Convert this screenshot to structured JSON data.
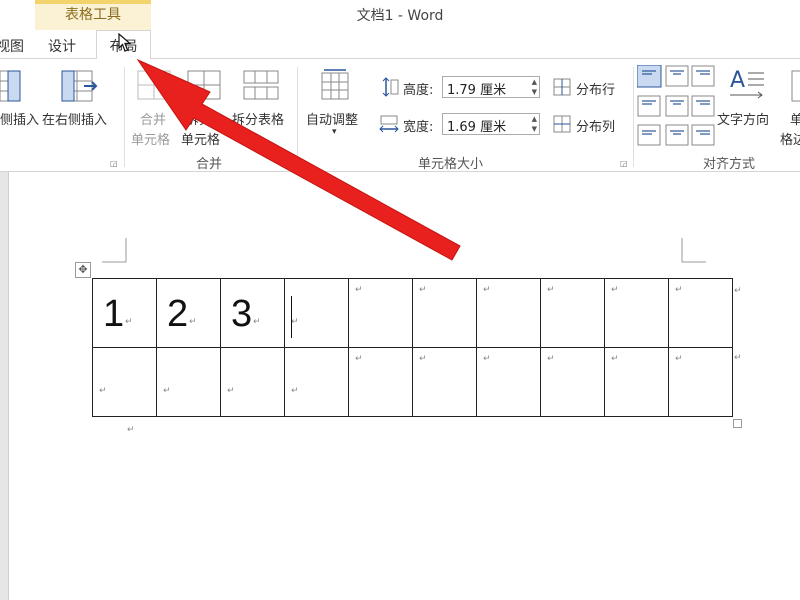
{
  "window": {
    "doc_title": "文档1 - Word",
    "context_tab_label": "表格工具"
  },
  "tabs": {
    "view_partial": "视图",
    "design": "设计",
    "layout": "布局"
  },
  "ribbon": {
    "insert_left_partial": "侧插入",
    "insert_right": "在右侧插入",
    "merge_cells_line1": "合并",
    "merge_cells_line2": "单元格",
    "split_cells_line1": "拆分",
    "split_cells_line2": "单元格",
    "split_table": "拆分表格",
    "merge_group": "合并",
    "autofit": "自动调整",
    "height_label": "高度:",
    "height_value": "1.79 厘米",
    "width_label": "宽度:",
    "width_value": "1.69 厘米",
    "distribute_rows": "分布行",
    "distribute_cols": "分布列",
    "cell_size_group": "单元格大小",
    "text_direction": "文字方向",
    "align_group": "对齐方式",
    "cell_margins_partial_1": "单",
    "cell_margins_partial_2": "格边"
  },
  "table": {
    "rows": [
      [
        "1",
        "2",
        "3",
        "",
        "",
        "",
        "",
        "",
        "",
        ""
      ],
      [
        "",
        "",
        "",
        "",
        "",
        "",
        "",
        "",
        "",
        ""
      ]
    ],
    "paragraph_mark": "↵"
  },
  "colors": {
    "accent": "#2b579a",
    "context_band": "#fbf1d5",
    "annotation_arrow": "#e8201e"
  }
}
